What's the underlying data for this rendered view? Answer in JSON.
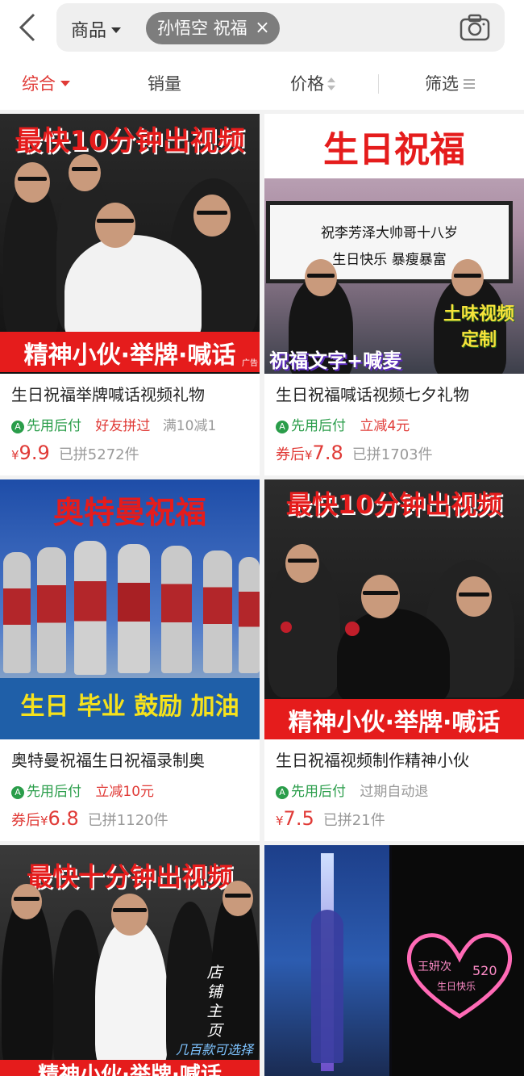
{
  "header": {
    "scope_label": "商品",
    "query": "孙悟空 祝福",
    "clear": "×"
  },
  "sort_tabs": [
    {
      "label": "综合"
    },
    {
      "label": "销量"
    },
    {
      "label": "价格"
    },
    {
      "label": "筛选"
    }
  ],
  "products": [
    {
      "image_text_top": "最快10分钟出视频",
      "image_text_bottom": "精神小伙·举牌·喊话",
      "ad_label": "广告",
      "title": "生日祝福举牌喊话视频礼物",
      "pay_tag": "先用后付",
      "promo": "好友拼过",
      "promo2": "满10减1",
      "coupon": "",
      "yen": "¥",
      "price": "9.9",
      "sold": "已拼5272件"
    },
    {
      "image_text_top": "生日祝福",
      "sign_line1": "祝李芳泽大帅哥十八岁",
      "sign_line2": "生日快乐 暴瘦暴富",
      "image_text_side1": "土味视频",
      "image_text_side2": "定制",
      "image_text_bottom": "祝福文字+喊麦",
      "title": "生日祝福喊话视频七夕礼物",
      "pay_tag": "先用后付",
      "promo": "立减4元",
      "coupon": "券后",
      "yen": "¥",
      "price": "7.8",
      "sold": "已拼1703件"
    },
    {
      "image_text_top": "奥特曼祝福",
      "image_text_bottom": "生日 毕业 鼓励 加油",
      "title": "奥特曼祝福生日祝福录制奥",
      "pay_tag": "先用后付",
      "promo": "立减10元",
      "coupon": "券后",
      "yen": "¥",
      "price": "6.8",
      "sold": "已拼1120件"
    },
    {
      "image_text_top": "最快10分钟出视频",
      "image_text_bottom": "精神小伙·举牌·喊话",
      "title": "生日祝福视频制作精神小伙",
      "pay_tag": "先用后付",
      "promo_grey": "过期自动退",
      "coupon": "",
      "yen": "¥",
      "price": "7.5",
      "sold": "已拼21件"
    },
    {
      "image_text_top": "最快十分钟出视频",
      "side_text": "店铺主页",
      "image_text_small": "几百款可选择",
      "image_text_bottom": "精神小伙·举牌·喊话"
    },
    {
      "heart_text1": "王妍次",
      "heart_text2": "520",
      "heart_text3": "生日快乐"
    }
  ]
}
